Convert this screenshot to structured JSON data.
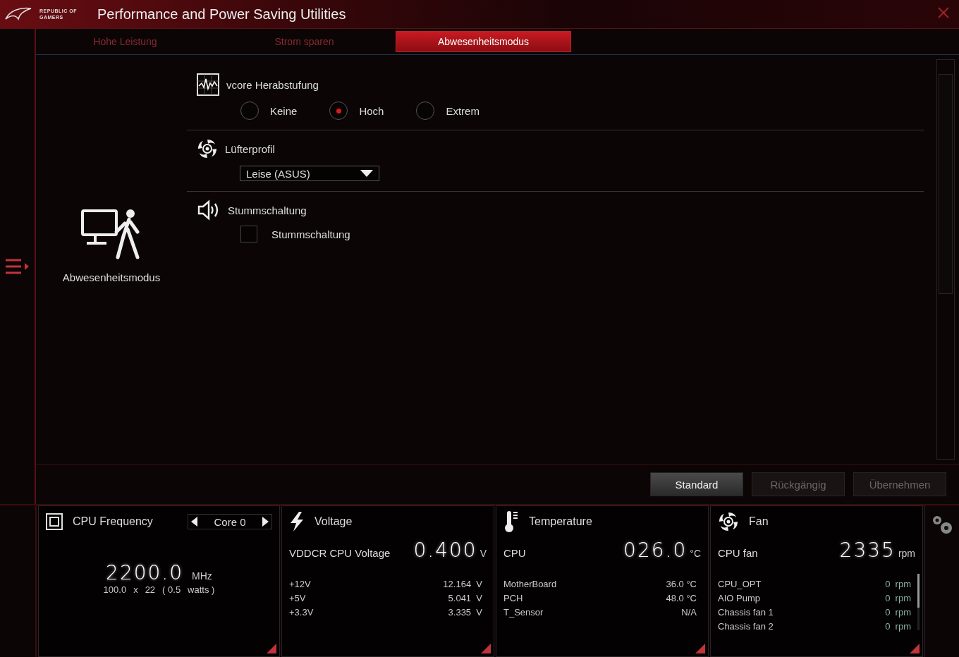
{
  "title_bar": {
    "logo_line_1": "REPUBLIC OF",
    "logo_line_2": "GAMERS",
    "title": "Performance and Power Saving Utilities"
  },
  "tabs": [
    {
      "label": "Hohe Leistung",
      "selected": false
    },
    {
      "label": "Strom sparen",
      "selected": false
    },
    {
      "label": "Abwesenheitsmodus",
      "selected": true
    }
  ],
  "mode": {
    "label": "Abwesenheitsmodus"
  },
  "sections": [
    {
      "kind": "radio",
      "title": "vcore Herabstufung",
      "options": [
        {
          "label": "Keine",
          "selected": false
        },
        {
          "label": "Hoch",
          "selected": true
        },
        {
          "label": "Extrem",
          "selected": false
        }
      ]
    },
    {
      "kind": "dropdown",
      "title": "Lüfterprofil",
      "value": "Leise (ASUS)"
    },
    {
      "kind": "checkbox",
      "title": "Stummschaltung",
      "label": "Stummschaltung",
      "checked": false
    }
  ],
  "buttons": [
    {
      "label": "Standard",
      "disabled": false
    },
    {
      "label": "Rückgängig",
      "disabled": true
    },
    {
      "label": "Übernehmen",
      "disabled": true
    }
  ],
  "monitors": [
    {
      "kind": "frequency",
      "title": "CPU Frequency",
      "core": "Core 0",
      "value": "2200.0",
      "unit": "MHz",
      "detail": [
        "100.0",
        "x",
        "22",
        "( 0.5",
        "watts )"
      ]
    },
    {
      "kind": "voltage",
      "title": "Voltage",
      "main_label": "VDDCR CPU Voltage",
      "value": "0.400",
      "unit": "V",
      "rows": [
        {
          "name": "+12V",
          "value": "12.164",
          "unit": "V"
        },
        {
          "name": "+5V",
          "value": "5.041",
          "unit": "V"
        },
        {
          "name": "+3.3V",
          "value": "3.335",
          "unit": "V"
        }
      ]
    },
    {
      "kind": "temperature",
      "title": "Temperature",
      "main_label": "CPU",
      "value": "026.0",
      "unit": "°C",
      "rows": [
        {
          "name": "MotherBoard",
          "value": "36.0 °C"
        },
        {
          "name": "PCH",
          "value": "48.0 °C"
        },
        {
          "name": "T_Sensor",
          "value": "N/A"
        }
      ]
    },
    {
      "kind": "fan",
      "title": "Fan",
      "main_label": "CPU fan",
      "value": "2335",
      "unit": "rpm",
      "rows": [
        {
          "name": "CPU_OPT",
          "value": "0",
          "unit": "rpm"
        },
        {
          "name": "AIO Pump",
          "value": "0",
          "unit": "rpm"
        },
        {
          "name": "Chassis fan 1",
          "value": "0",
          "unit": "rpm"
        },
        {
          "name": "Chassis fan 2",
          "value": "0",
          "unit": "rpm"
        }
      ]
    }
  ]
}
